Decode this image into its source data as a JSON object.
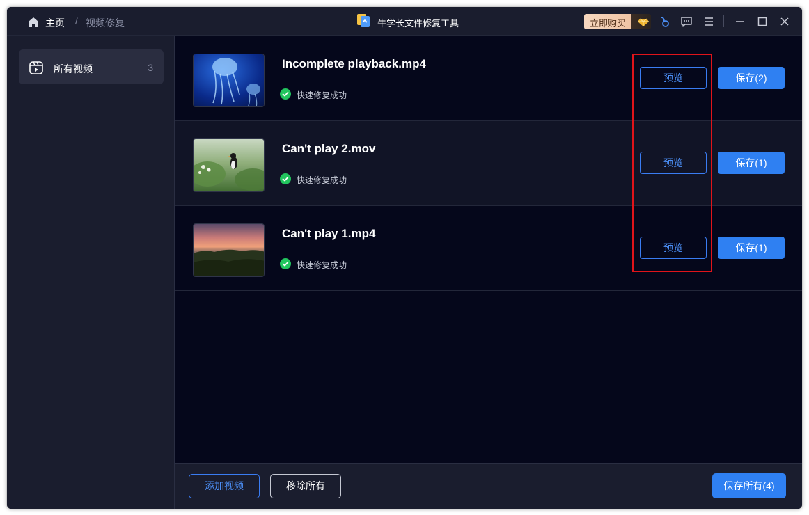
{
  "breadcrumb": {
    "home": "主页",
    "separator": "/",
    "current": "视频修复"
  },
  "app": {
    "title": "牛学长文件修复工具",
    "logo_icon": "app-logo-icon"
  },
  "titlebar": {
    "buy_label": "立即购买",
    "icons": [
      "diamond-icon",
      "link-icon",
      "feedback-icon",
      "menu-icon",
      "minimize-icon",
      "maximize-icon",
      "close-icon"
    ]
  },
  "sidebar": {
    "items": [
      {
        "label": "所有视频",
        "count": "3",
        "icon": "video-folder-icon"
      }
    ]
  },
  "videos": [
    {
      "name": "Incomplete playback.mp4",
      "status": "快速修复成功",
      "preview_label": "预览",
      "save_label": "保存(2)",
      "thumbnail": "jellyfish"
    },
    {
      "name": "Can't play 2.mov",
      "status": "快速修复成功",
      "preview_label": "预览",
      "save_label": "保存(1)",
      "thumbnail": "puffin"
    },
    {
      "name": "Can't play 1.mp4",
      "status": "快速修复成功",
      "preview_label": "预览",
      "save_label": "保存(1)",
      "thumbnail": "sunset"
    }
  ],
  "footer": {
    "add_label": "添加视频",
    "remove_label": "移除所有",
    "save_all_label": "保存所有(4)"
  },
  "colors": {
    "accent": "#2f80f2",
    "success": "#22c55e",
    "highlight": "#e0141a",
    "background": "#05071b",
    "panel": "#1a1d2e"
  }
}
